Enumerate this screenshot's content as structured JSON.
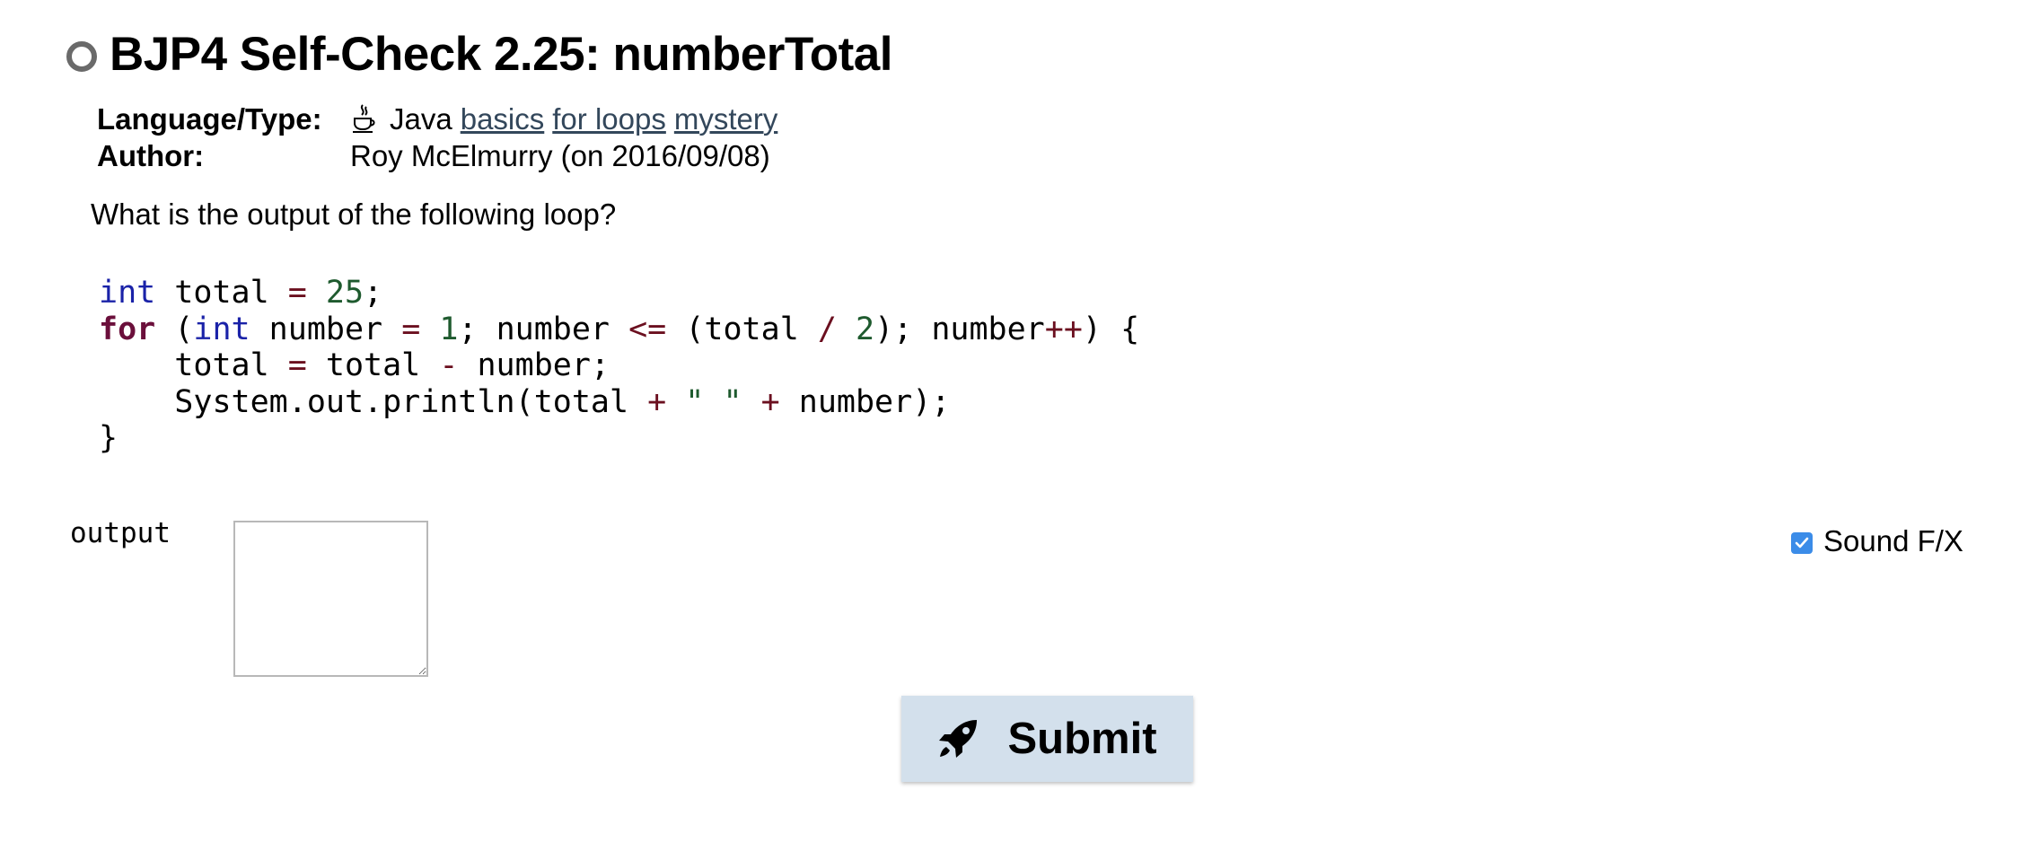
{
  "problem": {
    "title": "BJP4 Self-Check 2.25: numberTotal",
    "status": "unsolved"
  },
  "meta": {
    "language_label": "Language/Type:",
    "language": "Java",
    "tags": [
      "basics",
      "for loops",
      "mystery"
    ],
    "author_label": "Author:",
    "author": "Roy McElmurry (on 2016/09/08)"
  },
  "prompt": "What is the output of the following loop?",
  "code": {
    "lines": [
      "int total = 25;",
      "for (int number = 1; number <= (total / 2); number++) {",
      "    total = total - number;",
      "    System.out.println(total + \" \" + number);",
      "}"
    ]
  },
  "answer": {
    "label": "output",
    "value": ""
  },
  "sound_fx": {
    "label": "Sound F/X",
    "checked": true
  },
  "submit": {
    "label": "Submit"
  },
  "icons": {
    "status": "circle-outline-icon",
    "language": "java-cup-icon",
    "submit": "rocket-icon",
    "checkbox": "checkmark-icon"
  },
  "colors": {
    "keyword_type": "#1a22a8",
    "keyword_flow": "#6b0f3b",
    "operator": "#6b0f1f",
    "literal": "#1e5a2e",
    "link": "#33475b",
    "submit_bg": "#d3e0ec",
    "checkbox": "#3b8ce8"
  }
}
